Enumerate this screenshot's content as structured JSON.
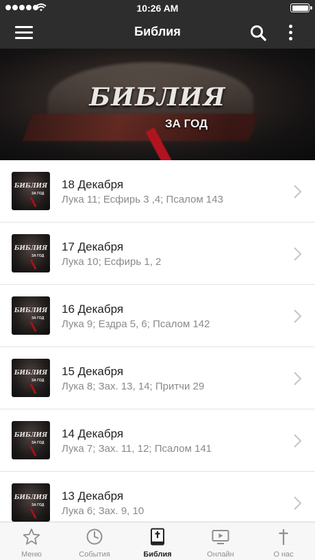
{
  "status": {
    "time": "10:26 AM"
  },
  "header": {
    "title": "Библия"
  },
  "banner": {
    "title": "БИБЛИЯ",
    "subtitle": "ЗА ГОД"
  },
  "thumb": {
    "title": "БИБЛИЯ",
    "subtitle": "ЗА ГОД"
  },
  "readings": [
    {
      "date": "18 Декабря",
      "refs": "Лука 11; Есфирь 3 ,4; Псалом 143"
    },
    {
      "date": "17 Декабря",
      "refs": "Лука 10; Есфирь 1, 2"
    },
    {
      "date": "16 Декабря",
      "refs": "Лука 9; Ездра 5, 6; Псалом 142"
    },
    {
      "date": "15 Декабря",
      "refs": "Лука 8; Зах. 13, 14; Притчи 29"
    },
    {
      "date": "14 Декабря",
      "refs": "Лука 7; Зах. 11, 12; Псалом 141"
    },
    {
      "date": "13 Декабря",
      "refs": "Лука 6; Зах. 9, 10"
    }
  ],
  "tabs": [
    {
      "label": "Меню",
      "icon": "star-icon"
    },
    {
      "label": "События",
      "icon": "clock-icon"
    },
    {
      "label": "Библия",
      "icon": "bible-icon",
      "active": true
    },
    {
      "label": "Онлайн",
      "icon": "play-screen-icon"
    },
    {
      "label": "О нас",
      "icon": "cross-icon"
    }
  ],
  "colors": {
    "bar": "#2d2d2d",
    "tab_active": "#222222",
    "tab_inactive": "#8f8f8f"
  }
}
